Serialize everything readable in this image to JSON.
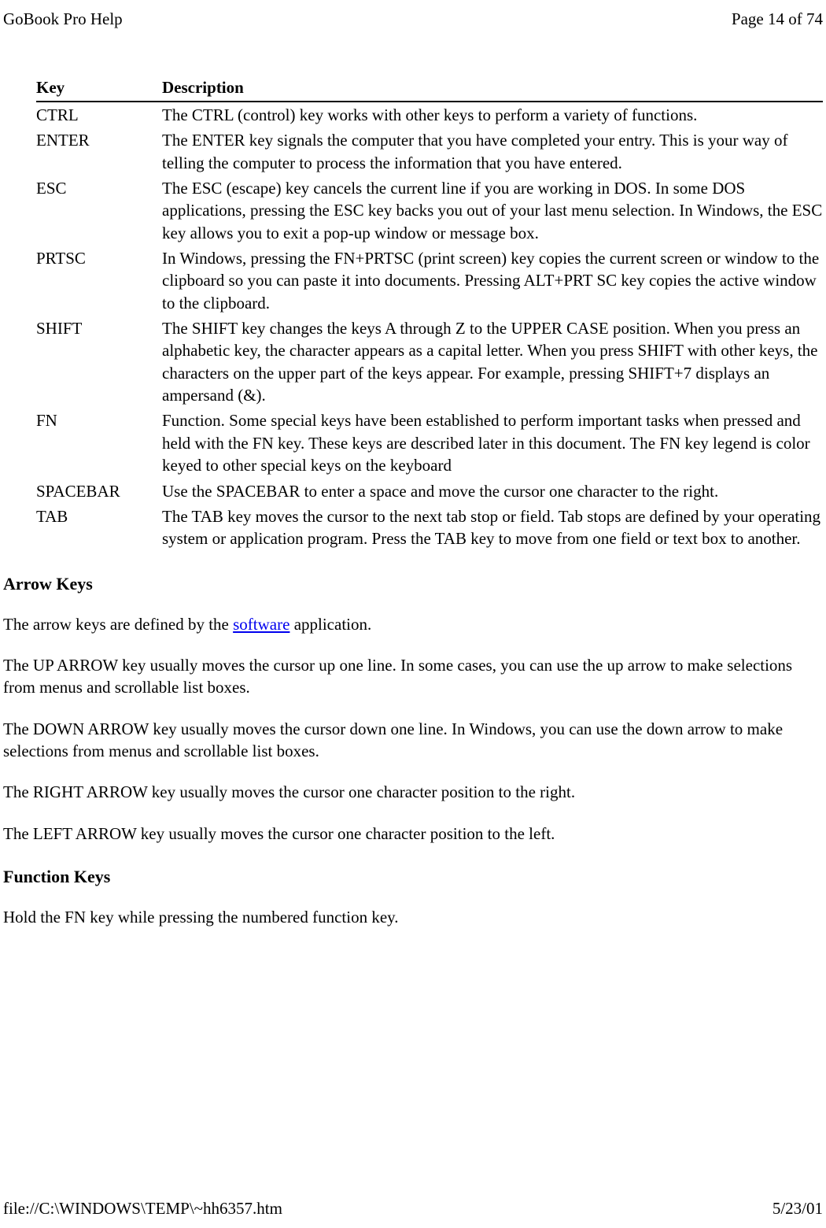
{
  "header": {
    "title": "GoBook Pro Help",
    "page_indicator": "Page 14 of 74"
  },
  "table": {
    "headers": {
      "key": "Key",
      "description": "Description"
    },
    "rows": [
      {
        "key": "CTRL",
        "description": "The CTRL (control) key works with other keys to perform a variety of functions."
      },
      {
        "key": "ENTER",
        "description": "The ENTER key signals the computer that you have completed your entry. This is your way of telling the computer to process the information that you have entered."
      },
      {
        "key": "ESC",
        "description": "The ESC (escape) key cancels the current line if you are working in DOS. In some DOS applications, pressing the ESC key backs you out of your last menu selection. In Windows, the ESC key allows you to exit a pop-up window or message box."
      },
      {
        "key": "PRTSC",
        "description": "In Windows, pressing the FN+PRTSC (print screen) key copies the current screen or window to the clipboard so you can paste it into documents. Pressing ALT+PRT SC key copies the active window to the clipboard."
      },
      {
        "key": "SHIFT",
        "description": "The SHIFT key changes the keys A through Z to the UPPER CASE position. When you press an alphabetic key, the character appears as a capital letter. When you press SHIFT with other keys, the characters on the upper part of the keys appear. For example, pressing SHIFT+7 displays an ampersand (&)."
      },
      {
        "key": "FN",
        "description": "Function. Some special keys have been established to perform important tasks when pressed and held with the FN key. These keys are described later in this document.  The FN key legend is color keyed to other special keys on the keyboard"
      },
      {
        "key": "SPACEBAR",
        "description": "Use the SPACEBAR to enter a space and move the cursor one character to the right."
      },
      {
        "key": "TAB",
        "description": "The TAB key moves the cursor to the next tab stop or field. Tab stops are defined by your operating system or application program. Press the TAB key to move from one field or text box to another."
      }
    ]
  },
  "sections": {
    "arrow_keys": {
      "heading": "Arrow Keys",
      "intro_prefix": "The arrow keys are defined by the ",
      "intro_link": "software",
      "intro_suffix": " application.",
      "up": "The UP ARROW key usually moves the cursor up one line. In some cases, you can use the up arrow to make selections from menus and scrollable list boxes.",
      "down": "The DOWN ARROW key usually moves the cursor down one line. In Windows, you can use the down arrow to make selections from menus and scrollable list boxes.",
      "right": "The RIGHT ARROW key usually moves the cursor one character position to the right.",
      "left": "The LEFT ARROW key usually moves the cursor one character position to the left."
    },
    "function_keys": {
      "heading": "Function Keys",
      "body": "Hold the FN key while pressing the numbered function key."
    }
  },
  "footer": {
    "path": "file://C:\\WINDOWS\\TEMP\\~hh6357.htm",
    "date": "5/23/01"
  }
}
